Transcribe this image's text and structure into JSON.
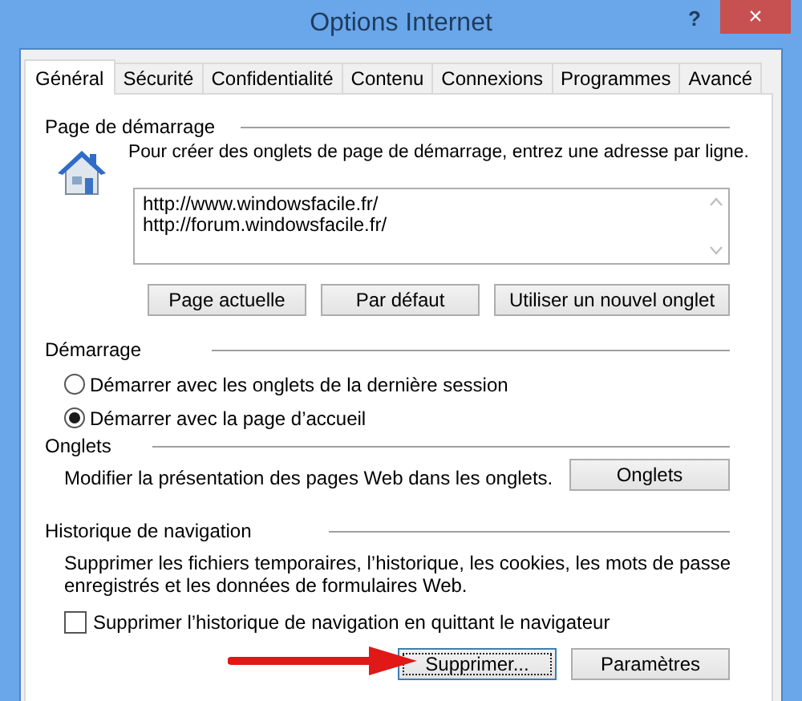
{
  "window": {
    "title": "Options Internet",
    "help": "?",
    "close": "×"
  },
  "tabs": [
    {
      "label": "Général",
      "selected": true
    },
    {
      "label": "Sécurité",
      "selected": false
    },
    {
      "label": "Confidentialité",
      "selected": false
    },
    {
      "label": "Contenu",
      "selected": false
    },
    {
      "label": "Connexions",
      "selected": false
    },
    {
      "label": "Programmes",
      "selected": false
    },
    {
      "label": "Avancé",
      "selected": false
    }
  ],
  "start_page": {
    "heading": "Page de démarrage",
    "description": "Pour créer des onglets de page de démarrage, entrez une adresse par ligne.",
    "urls": [
      "http://www.windowsfacile.fr/",
      "http://forum.windowsfacile.fr/"
    ],
    "buttons": [
      "Page actuelle",
      "Par défaut",
      "Utiliser un nouvel onglet"
    ]
  },
  "startup": {
    "heading": "Démarrage",
    "options": [
      {
        "label": "Démarrer avec les onglets de la dernière session",
        "selected": false
      },
      {
        "label": "Démarrer avec la page d’accueil",
        "selected": true
      }
    ]
  },
  "tabs_section": {
    "heading": "Onglets",
    "description": "Modifier la présentation des pages Web dans les onglets.",
    "button": "Onglets"
  },
  "history": {
    "heading": "Historique de navigation",
    "description": "Supprimer les fichiers temporaires, l’historique, les cookies, les mots de passe enregistrés et les données de formulaires Web.",
    "checkbox": {
      "label": "Supprimer l’historique de navigation en quittant le navigateur",
      "checked": false
    },
    "buttons": [
      {
        "label": "Supprimer...",
        "focused": true
      },
      {
        "label": "Paramètres",
        "focused": false
      }
    ]
  }
}
